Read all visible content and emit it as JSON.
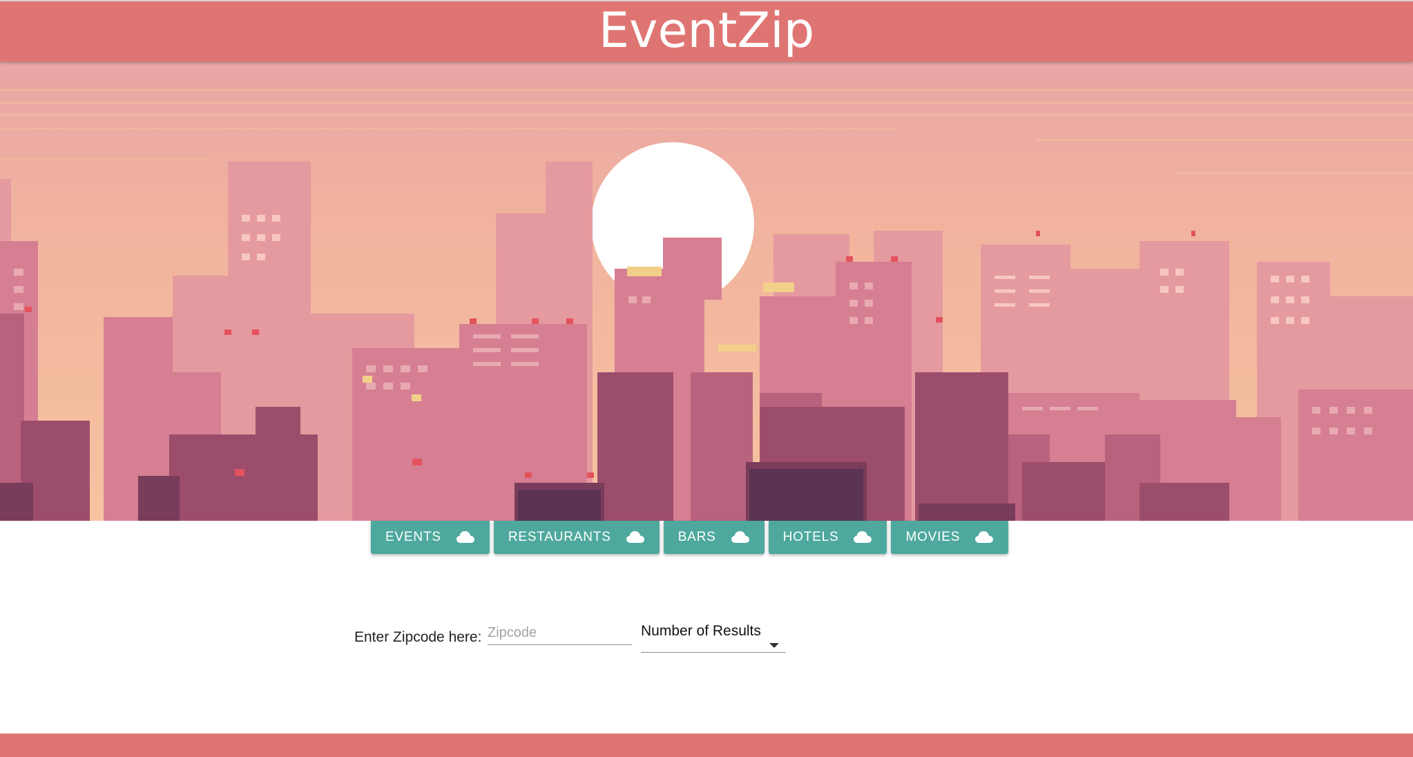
{
  "header": {
    "title": "EventZip"
  },
  "nav": {
    "buttons": [
      {
        "label": "EVENTS",
        "icon": "cloud-icon"
      },
      {
        "label": "RESTAURANTS",
        "icon": "cloud-icon"
      },
      {
        "label": "BARS",
        "icon": "cloud-icon"
      },
      {
        "label": "HOTELS",
        "icon": "cloud-icon"
      },
      {
        "label": "MOVIES",
        "icon": "cloud-icon"
      }
    ]
  },
  "form": {
    "zip_label": "Enter Zipcode here:",
    "zip_placeholder": "Zipcode",
    "zip_value": "",
    "results_select_value": "Number of Results"
  },
  "colors": {
    "brand": "#df7573",
    "button": "#4ea89d",
    "sky_top": "#e8a5a5",
    "sky_bottom": "#f6c3a0",
    "sun": "#ffffff"
  }
}
